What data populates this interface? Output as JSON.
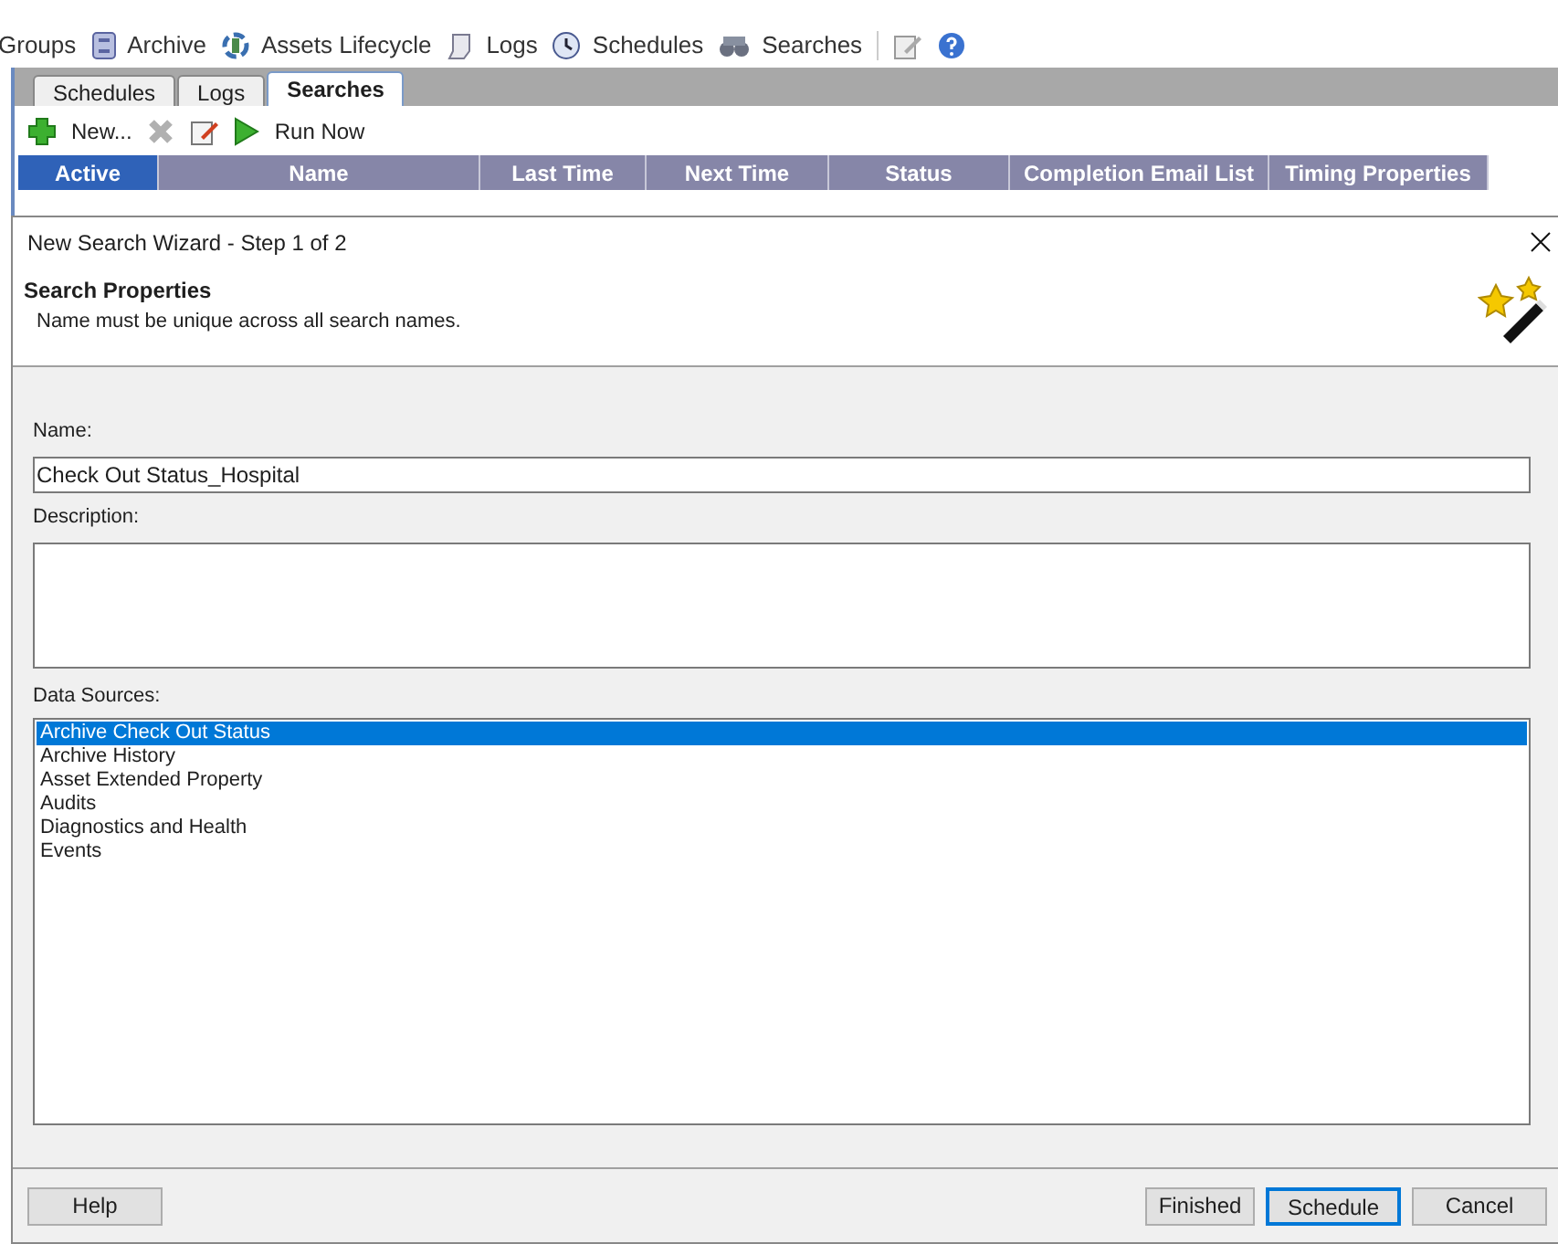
{
  "nav": [
    {
      "label": "Groups",
      "kind": "none"
    },
    {
      "label": "Archive",
      "kind": "archive"
    },
    {
      "label": "Assets Lifecycle",
      "kind": "cycle"
    },
    {
      "label": "Logs",
      "kind": "log"
    },
    {
      "label": "Schedules",
      "kind": "clock"
    },
    {
      "label": "Searches",
      "kind": "binoculars"
    }
  ],
  "tabs": [
    {
      "label": "Schedules",
      "selected": false
    },
    {
      "label": "Logs",
      "selected": false
    },
    {
      "label": "Searches",
      "selected": true
    }
  ],
  "toolbar": [
    {
      "label": "New...",
      "kind": "plus",
      "disabled": false
    },
    {
      "kind": "delete",
      "disabled": true
    },
    {
      "kind": "edit",
      "disabled": false
    },
    {
      "label": "Run Now",
      "kind": "play",
      "disabled": false
    }
  ],
  "columns": [
    {
      "label": "Active",
      "selected": true
    },
    {
      "label": "Name",
      "selected": false
    },
    {
      "label": "Last Time",
      "selected": false
    },
    {
      "label": "Next Time",
      "selected": false
    },
    {
      "label": "Status",
      "selected": false
    },
    {
      "label": "Completion Email List",
      "selected": false
    },
    {
      "label": "Timing Properties",
      "selected": false
    }
  ],
  "dialog": {
    "title": "New Search Wizard - Step 1 of 2",
    "heading": "Search Properties",
    "subtitle": "Name must be unique across all search names.",
    "name_label": "Name:",
    "name_value": "Check Out Status_Hospital",
    "description_label": "Description:",
    "sources_label": "Data Sources:",
    "sources": [
      {
        "label": "Archive Check Out Status",
        "selected": true
      },
      {
        "label": "Archive History",
        "selected": false
      },
      {
        "label": "Asset Extended Property",
        "selected": false
      },
      {
        "label": "Audits",
        "selected": false
      },
      {
        "label": "Diagnostics and Health",
        "selected": false
      },
      {
        "label": "Events",
        "selected": false
      }
    ],
    "help": "Help",
    "buttons": [
      {
        "label": "Finished",
        "focused": false
      },
      {
        "label": "Schedule",
        "focused": true
      },
      {
        "label": "Cancel",
        "focused": false
      }
    ]
  }
}
